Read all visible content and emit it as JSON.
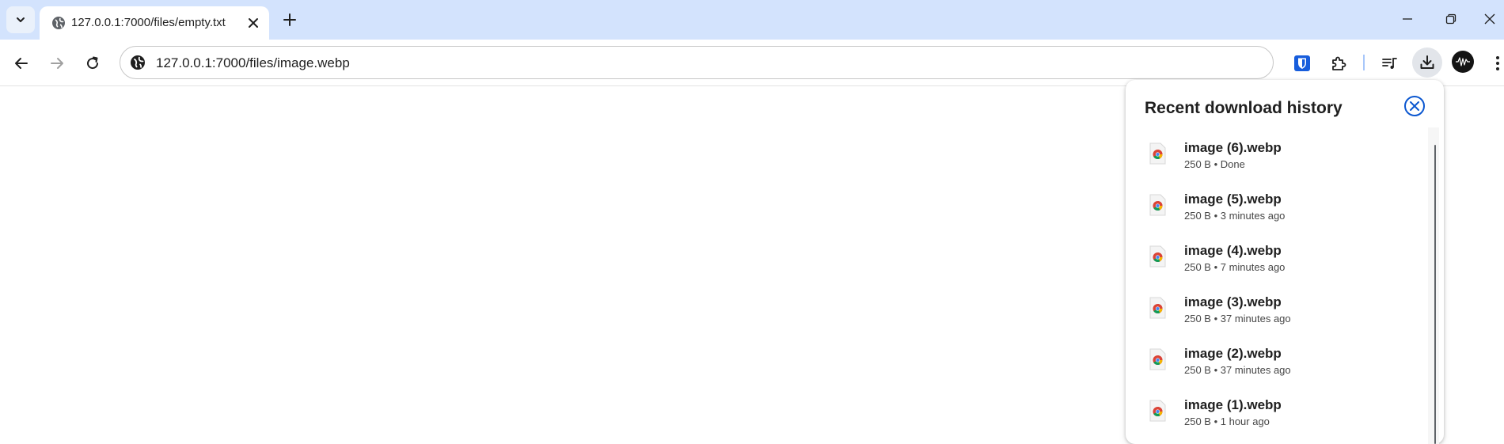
{
  "tab": {
    "title": "127.0.0.1:7000/files/empty.txt",
    "favicon": "globe-icon"
  },
  "toolbar": {
    "url": "127.0.0.1:7000/files/image.webp",
    "site_info_icon": "globe-icon"
  },
  "colors": {
    "tabstrip_bg": "#d3e3fd",
    "accent": "#0b57d0",
    "bitwarden": "#175ddc"
  },
  "download_bubble": {
    "title": "Recent download history",
    "items": [
      {
        "name": "image (6).webp",
        "meta": "250 B • Done"
      },
      {
        "name": "image (5).webp",
        "meta": "250 B • 3 minutes ago"
      },
      {
        "name": "image (4).webp",
        "meta": "250 B • 7 minutes ago"
      },
      {
        "name": "image (3).webp",
        "meta": "250 B • 37 minutes ago"
      },
      {
        "name": "image (2).webp",
        "meta": "250 B • 37 minutes ago"
      },
      {
        "name": "image (1).webp",
        "meta": "250 B • 1 hour ago"
      }
    ]
  }
}
